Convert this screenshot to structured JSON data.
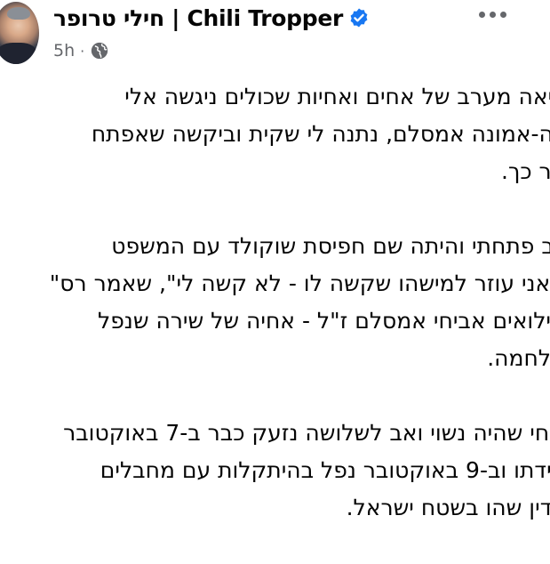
{
  "post": {
    "author": {
      "name": "חילי טרופר | Chili Tropper",
      "verified": true,
      "avatar_icon": "profile-photo"
    },
    "timestamp": "5h",
    "separator": "·",
    "audience_icon": "globe-icon",
    "more_icon": "more-options-icon",
    "paragraphs": [
      {
        "lines": [
          "ציאה מערב של אחים ואחיות שכולים ניגשה אלי",
          "רה-אמונה אמסלם, נתנה לי שקית וביקשה שאפתח",
          "חר כך."
        ]
      },
      {
        "lines": [
          "כב פתחתי והיתה שם חפיסת שוקולד עם המשפט",
          "שאני עוזר למישהו שקשה לו - לא קשה לי\", שאמר רס\"",
          "מילואים אביחי אמסלם ז\"ל - אחיה של שירה שנפל",
          "מלחמה."
        ]
      },
      {
        "lines": [
          "כיחי שהיה נשוי ואב לשלושה נזעק כבר ב-7 באוקטובר",
          "חידתו וב-9 באוקטובר נפל בהיתקלות עם מחבלים",
          "עדין שהו בשטח ישראל."
        ]
      }
    ]
  },
  "colors": {
    "text": "#050505",
    "secondary_text": "#65676b",
    "verified_blue": "#1877f2",
    "background": "#ffffff"
  }
}
